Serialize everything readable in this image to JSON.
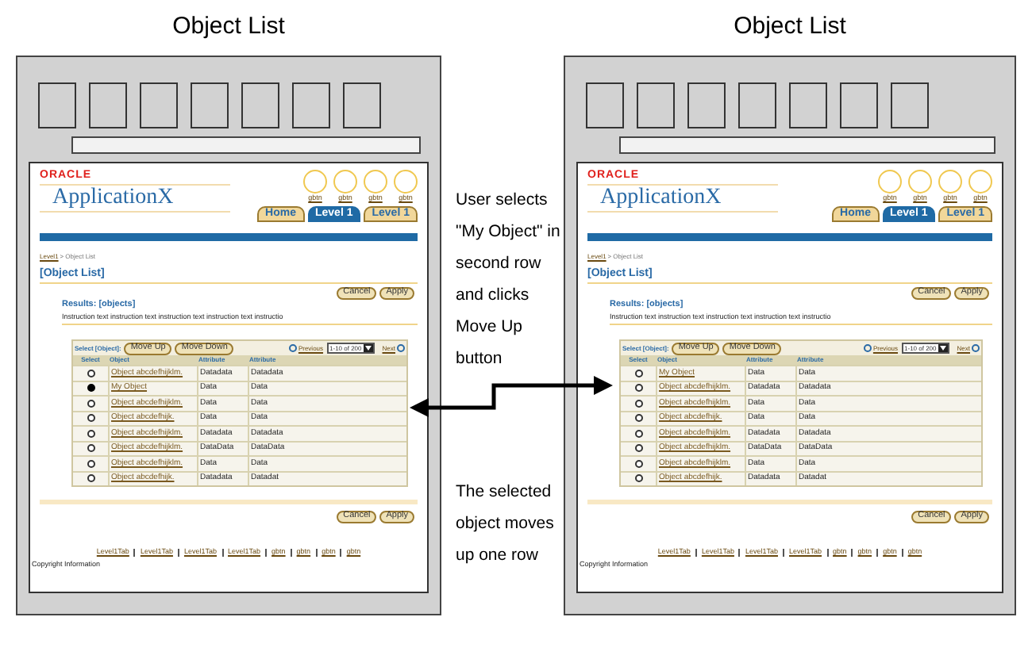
{
  "panels": [
    {
      "title": "Object List",
      "page": {
        "logo": "ORACLE",
        "app_name": "ApplicationX",
        "global_buttons": [
          "gbtn",
          "gbtn",
          "gbtn",
          "gbtn"
        ],
        "tabs": [
          {
            "label": "Home",
            "selected": false
          },
          {
            "label": "Level 1",
            "selected": true
          },
          {
            "label": "Level 1",
            "selected": false
          }
        ],
        "breadcrumb": {
          "items": [
            "Level1",
            "Object List"
          ],
          "separator": ">"
        },
        "heading": "[Object List]",
        "top_buttons": [
          "Cancel",
          "Apply"
        ],
        "results": "Results: [objects]",
        "instruction": "Instruction text instruction text instruction text instruction text instructio",
        "table": {
          "select_label": "Select [Object]:",
          "actions": [
            "Move Up",
            "Move Down"
          ],
          "previous": "Previous",
          "range": "1-10 of 200",
          "next": "Next",
          "columns": [
            "Select",
            "Object",
            "Attribute",
            "Attribute"
          ],
          "rows": [
            {
              "selected": false,
              "object": "Object abcdefhijklm.",
              "attribute_1": "Datadata",
              "attribute_2": "Datadata"
            },
            {
              "selected": true,
              "object": "My Object",
              "attribute_1": "Data",
              "attribute_2": "Data"
            },
            {
              "selected": false,
              "object": "Object abcdefhijklm.",
              "attribute_1": "Data",
              "attribute_2": "Data"
            },
            {
              "selected": false,
              "object": "Object abcdefhijk.",
              "attribute_1": "Data",
              "attribute_2": "Data"
            },
            {
              "selected": false,
              "object": "Object abcdefhijklm.",
              "attribute_1": "Datadata",
              "attribute_2": "Datadata"
            },
            {
              "selected": false,
              "object": "Object abcdefhijklm.",
              "attribute_1": "DataData",
              "attribute_2": "DataData"
            },
            {
              "selected": false,
              "object": "Object abcdefhijklm.",
              "attribute_1": "Data",
              "attribute_2": "Data"
            },
            {
              "selected": false,
              "object": "Object abcdefhijk.",
              "attribute_1": "Datadata",
              "attribute_2": "Datadat"
            }
          ]
        },
        "bottom_buttons": [
          "Cancel",
          "Apply"
        ],
        "footer_links": [
          "Level1Tab",
          "Level1Tab",
          "Level1Tab",
          "Level1Tab",
          "gbtn",
          "gbtn",
          "gbtn",
          "gbtn"
        ],
        "copyright": "Copyright Information"
      }
    },
    {
      "title": "Object List",
      "page": {
        "logo": "ORACLE",
        "app_name": "ApplicationX",
        "global_buttons": [
          "gbtn",
          "gbtn",
          "gbtn",
          "gbtn"
        ],
        "tabs": [
          {
            "label": "Home",
            "selected": false
          },
          {
            "label": "Level 1",
            "selected": true
          },
          {
            "label": "Level 1",
            "selected": false
          }
        ],
        "breadcrumb": {
          "items": [
            "Level1",
            "Object List"
          ],
          "separator": ">"
        },
        "heading": "[Object List]",
        "top_buttons": [
          "Cancel",
          "Apply"
        ],
        "results": "Results: [objects]",
        "instruction": "Instruction text instruction text instruction text instruction text instructio",
        "table": {
          "select_label": "Select [Object]:",
          "actions": [
            "Move Up",
            "Move Down"
          ],
          "previous": "Previous",
          "range": "1-10 of 200",
          "next": "Next",
          "columns": [
            "Select",
            "Object",
            "Attribute",
            "Attribute"
          ],
          "rows": [
            {
              "selected": false,
              "object": "My Object",
              "attribute_1": "Data",
              "attribute_2": "Data"
            },
            {
              "selected": false,
              "object": "Object abcdefhijklm.",
              "attribute_1": "Datadata",
              "attribute_2": "Datadata"
            },
            {
              "selected": false,
              "object": "Object abcdefhijklm.",
              "attribute_1": "Data",
              "attribute_2": "Data"
            },
            {
              "selected": false,
              "object": "Object abcdefhijk.",
              "attribute_1": "Data",
              "attribute_2": "Data"
            },
            {
              "selected": false,
              "object": "Object abcdefhijklm.",
              "attribute_1": "Datadata",
              "attribute_2": "Datadata"
            },
            {
              "selected": false,
              "object": "Object abcdefhijklm.",
              "attribute_1": "DataData",
              "attribute_2": "DataData"
            },
            {
              "selected": false,
              "object": "Object abcdefhijklm.",
              "attribute_1": "Data",
              "attribute_2": "Data"
            },
            {
              "selected": false,
              "object": "Object abcdefhijk.",
              "attribute_1": "Datadata",
              "attribute_2": "Datadat"
            }
          ]
        },
        "bottom_buttons": [
          "Cancel",
          "Apply"
        ],
        "footer_links": [
          "Level1Tab",
          "Level1Tab",
          "Level1Tab",
          "Level1Tab",
          "gbtn",
          "gbtn",
          "gbtn",
          "gbtn"
        ],
        "copyright": "Copyright Information"
      }
    }
  ],
  "annotations": [
    {
      "text": "User selects \"My Object\" in second row and clicks Move Up button"
    },
    {
      "text": "The selected object moves up one row"
    }
  ]
}
